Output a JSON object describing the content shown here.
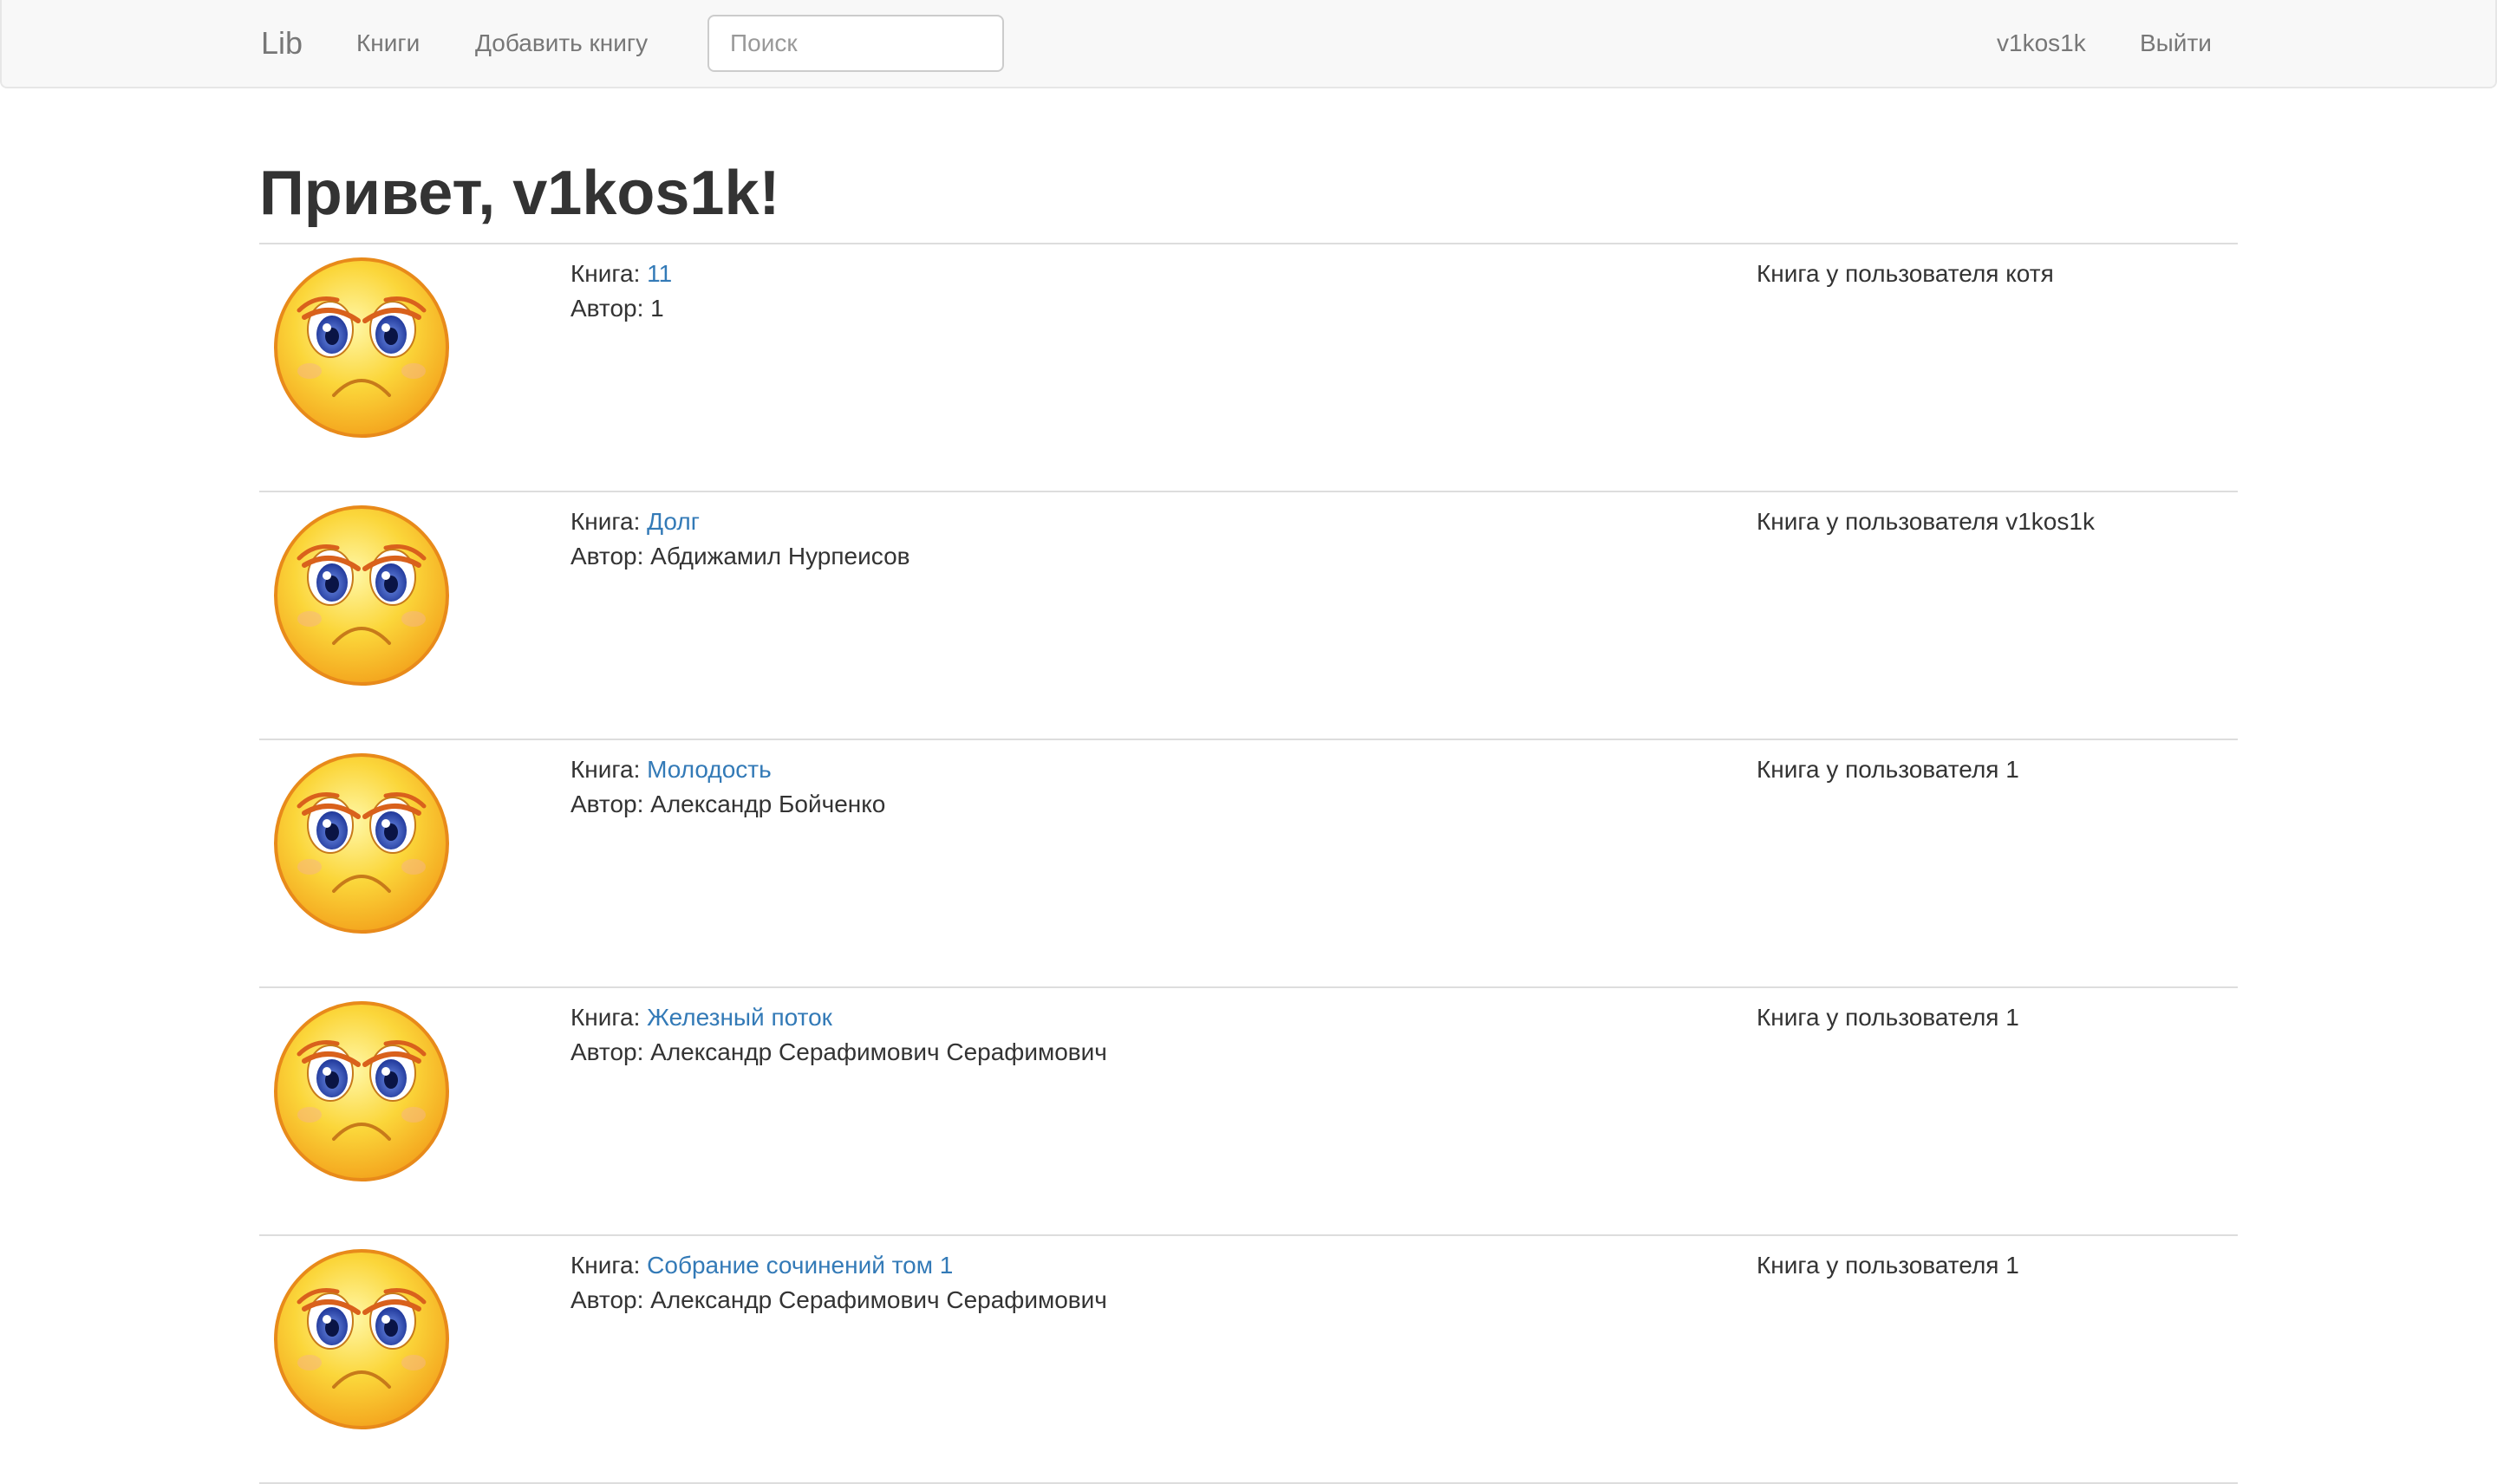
{
  "navbar": {
    "brand": "Lib",
    "books_link": "Книги",
    "add_book_link": "Добавить книгу",
    "search_placeholder": "Поиск",
    "username": "v1kos1k",
    "logout": "Выйти"
  },
  "main": {
    "greeting": "Привет, v1kos1k!"
  },
  "labels": {
    "book": "Книга:",
    "author": "Автор:",
    "cover_icon": "sad-face-icon"
  },
  "books": [
    {
      "title": "11",
      "author": "1",
      "holder_text": "Книга у пользователя котя"
    },
    {
      "title": "Долг",
      "author": "Абдижамил Нурпеисов",
      "holder_text": "Книга у пользователя v1kos1k"
    },
    {
      "title": "Молодость",
      "author": "Александр Бойченко",
      "holder_text": "Книга у пользователя 1"
    },
    {
      "title": "Железный поток",
      "author": "Александр Серафимович Серафимович",
      "holder_text": "Книга у пользователя 1"
    },
    {
      "title": "Собрание сочинений том 1",
      "author": "Александр Серафимович Серафимович",
      "holder_text": "Книга у пользователя 1"
    }
  ],
  "colors": {
    "navbar_bg": "#f8f8f8",
    "link": "#337ab7",
    "nav_text": "#777777",
    "text": "#333333"
  }
}
